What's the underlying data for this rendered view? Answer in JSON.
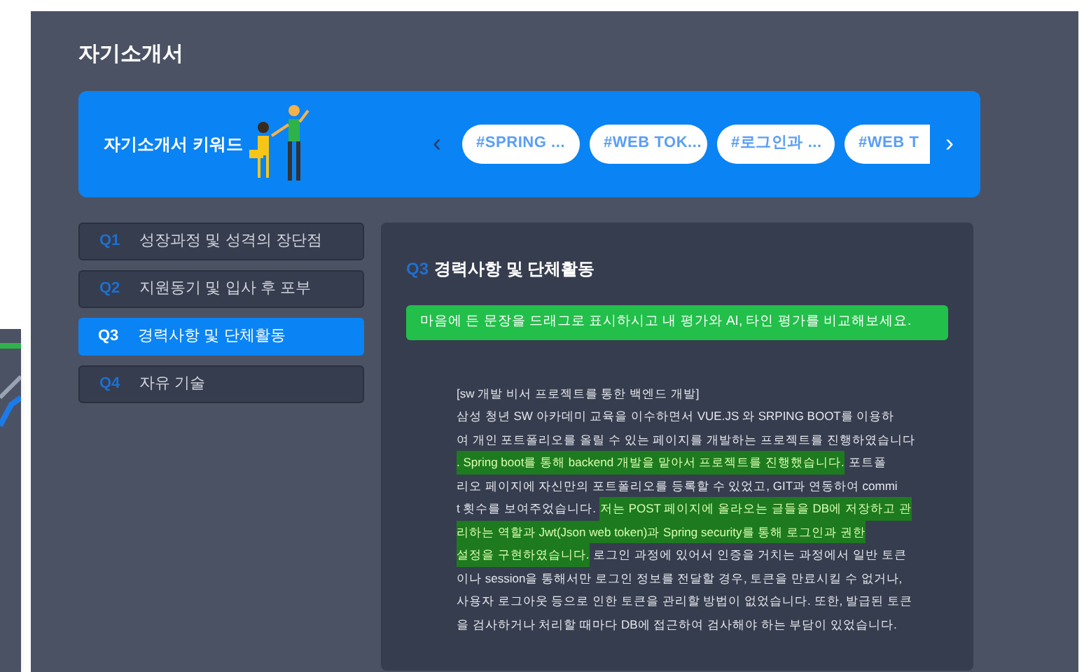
{
  "page": {
    "title": "자기소개서"
  },
  "keywords": {
    "label": "자기소개서 키워드",
    "prev": "‹",
    "next": "›",
    "chips": [
      "#SPRING ...",
      "#WEB TOK...",
      "#로그인과 ...",
      "#WEB T"
    ]
  },
  "questions": [
    {
      "number": "Q1",
      "label": "성장과정 및 성격의 장단점",
      "selected": false
    },
    {
      "number": "Q2",
      "label": "지원동기 및 입사 후 포부",
      "selected": false
    },
    {
      "number": "Q3",
      "label": "경력사항 및 단체활동",
      "selected": true
    },
    {
      "number": "Q4",
      "label": "자유 기술",
      "selected": false
    }
  ],
  "answer": {
    "number": "Q3",
    "title": "경력사항 및 단체활동",
    "notice": "마음에 든 문장을 드래그로 표시하시고 내 평가와 AI, 타인 평가를 비교해보세요.",
    "heading": "[sw 개발 비서 프로젝트를 통한 백엔드 개발]",
    "lines": [
      [
        {
          "text": "삼성 청년 SW 아카데미 교육을 이수하면서 VUE.JS 와 SRPING BOOT를 이용하",
          "highlighted": false
        }
      ],
      [
        {
          "text": "여 개인 포트폴리오를 올릴 수 있는 페이지를 개발하는 프로젝트를 진행하였습니다",
          "highlighted": false
        }
      ],
      [
        {
          "text": ". Spring boot를 통해 backend 개발을 맡아서 프로젝트를 진행했습니다.",
          "highlighted": true
        },
        {
          "text": "포트폴",
          "highlighted": false
        }
      ],
      [
        {
          "text": "리오 페이지에 자신만의 포트폴리오를 등록할 수 있었고, GIT과 연동하여 commi",
          "highlighted": false
        }
      ],
      [
        {
          "text": "t 횟수를 보여주었습니다.",
          "highlighted": false
        },
        {
          "text": "저는 POST 페이지에 올라오는 글들을 DB에 저장하고 관",
          "highlighted": true
        }
      ],
      [
        {
          "text": "리하는 역할과 Jwt(Json web token)과 Spring security를 통해 로그인과 권한",
          "highlighted": true
        }
      ],
      [
        {
          "text": "설정을 구현하였습니다.",
          "highlighted": true
        },
        {
          "text": "로그인 과정에 있어서 인증을 거치는 과정에서 일반 토큰",
          "highlighted": false
        }
      ],
      [
        {
          "text": "이나 session을 통해서만 로그인 정보를 전달할 경우, 토큰을 만료시킬 수 없거나,",
          "highlighted": false
        }
      ],
      [
        {
          "text": "사용자 로그아웃 등으로 인한 토큰을 관리할 방법이 없었습니다. 또한, 발급된 토큰",
          "highlighted": false
        }
      ],
      [
        {
          "text": "을 검사하거나 처리할 때마다 DB에 접근하여 검사해야 하는 부담이 있었습니다.",
          "highlighted": false
        }
      ]
    ]
  }
}
